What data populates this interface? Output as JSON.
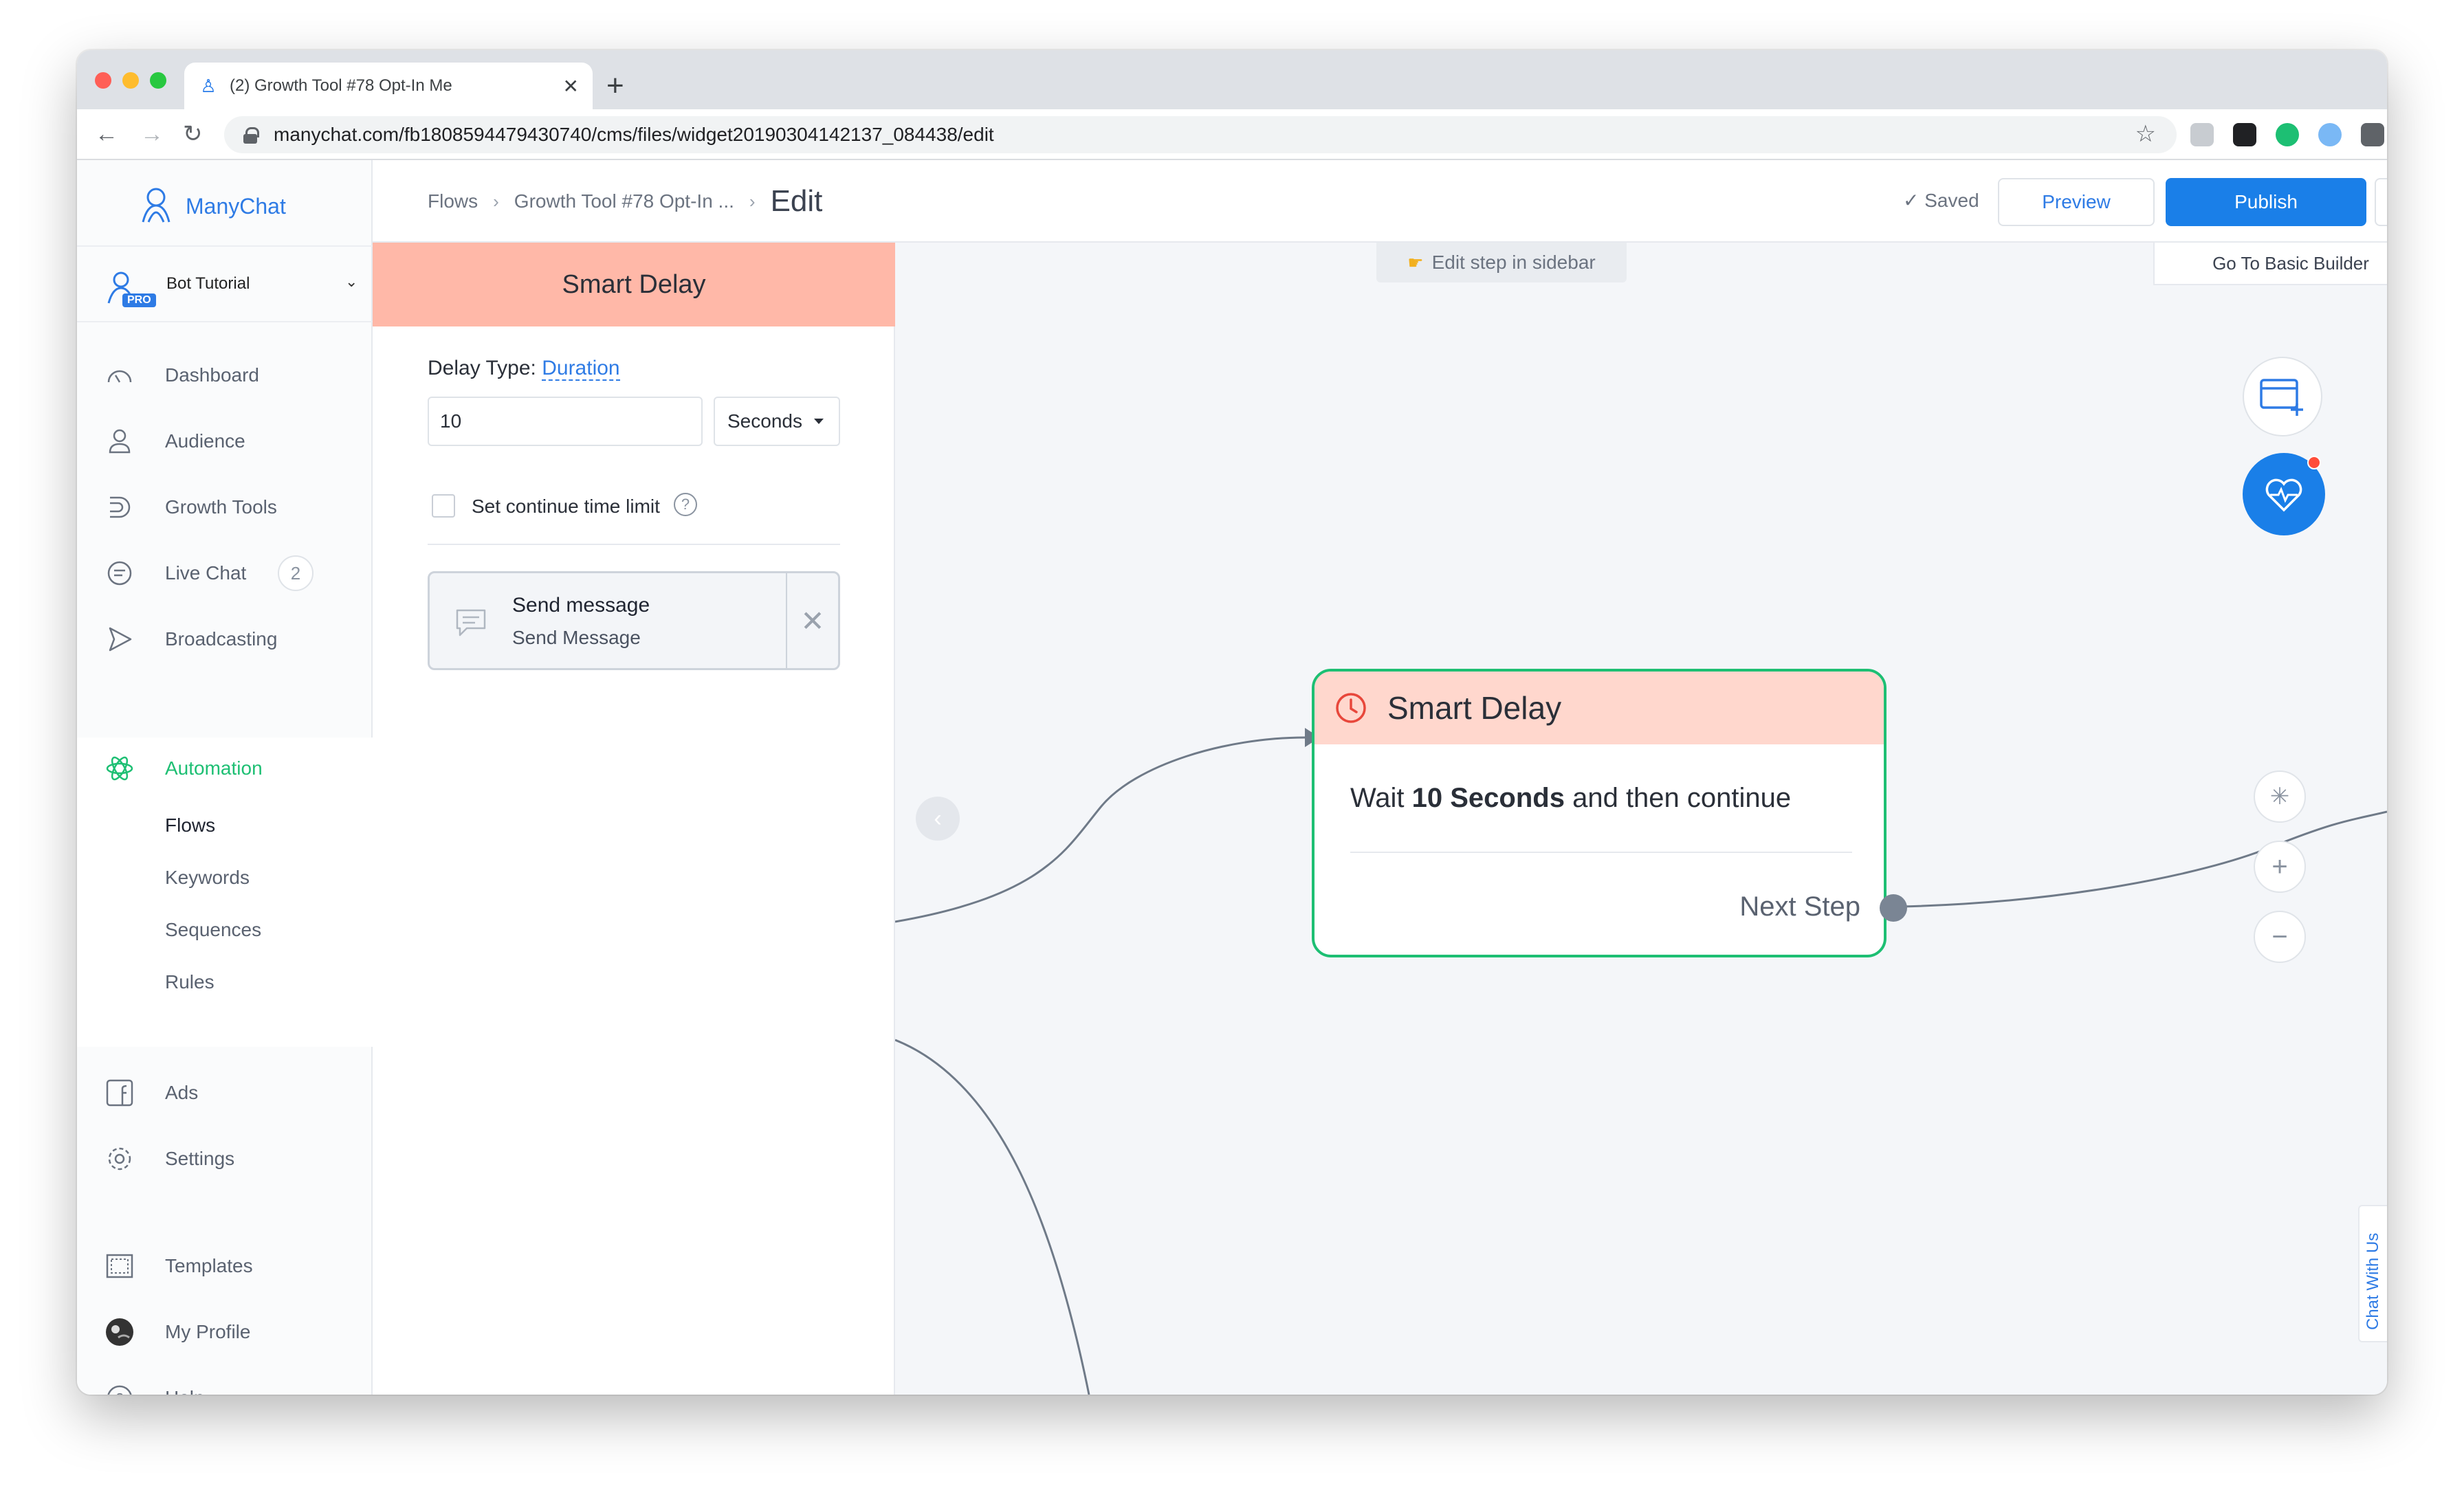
{
  "browser": {
    "tab_title": "(2) Growth Tool #78 Opt-In Me",
    "url": "manychat.com/fb1808594479430740/cms/files/widget20190304142137_084438/edit"
  },
  "sidebar": {
    "logo_text": "ManyChat",
    "bot_name": "Bot Tutorial",
    "pro_badge": "PRO",
    "items": [
      {
        "label": "Dashboard",
        "icon": "dashboard-icon"
      },
      {
        "label": "Audience",
        "icon": "user-icon"
      },
      {
        "label": "Growth Tools",
        "icon": "growth-tools-icon"
      },
      {
        "label": "Live Chat",
        "icon": "chat-bubble-icon",
        "badge": "2"
      },
      {
        "label": "Broadcasting",
        "icon": "send-icon"
      },
      {
        "label": "Automation",
        "icon": "atom-icon"
      },
      {
        "label": "Ads",
        "icon": "facebook-icon"
      },
      {
        "label": "Settings",
        "icon": "gear-icon"
      },
      {
        "label": "Templates",
        "icon": "template-icon"
      },
      {
        "label": "My Profile",
        "icon": "avatar-icon"
      },
      {
        "label": "Help",
        "icon": "help-icon"
      }
    ],
    "automation_sub": [
      "Flows",
      "Keywords",
      "Sequences",
      "Rules"
    ]
  },
  "header": {
    "breadcrumb": [
      "Flows",
      "Growth Tool #78 Opt-In ..."
    ],
    "page_title": "Edit",
    "saved": "Saved",
    "preview": "Preview",
    "publish": "Publish",
    "more": "⋮"
  },
  "panel": {
    "title": "Smart Delay",
    "delay_type_label": "Delay Type:",
    "delay_type_value": "Duration",
    "amount": "10",
    "unit": "Seconds",
    "continue_limit_label": "Set continue time limit",
    "message_card": {
      "title": "Send message",
      "subtitle": "Send Message"
    }
  },
  "canvas": {
    "hint": "Edit step in sidebar",
    "basic_builder": "Go To Basic Builder",
    "chat_with_us": "Chat With Us",
    "node": {
      "title": "Smart Delay",
      "body_pre": "Wait",
      "body_bold": "10 Seconds",
      "body_post": "and then continue",
      "next_step": "Next Step"
    }
  },
  "colors": {
    "brand_blue": "#1a7fe8",
    "automation_green": "#1dbf73",
    "delay_header": "#ffb8a8",
    "node_header": "#ffd7cd"
  }
}
